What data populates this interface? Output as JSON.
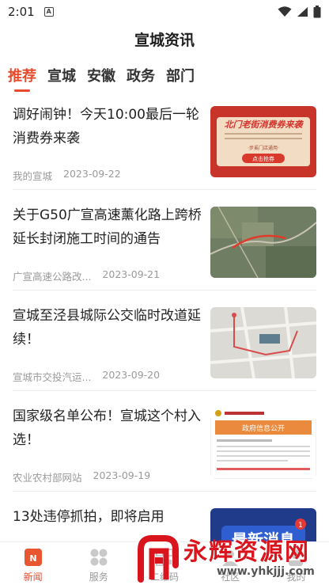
{
  "status": {
    "time": "2:01",
    "indicator": "A"
  },
  "app": {
    "title": "宣城资讯"
  },
  "tabs": [
    {
      "label": "推荐",
      "active": true
    },
    {
      "label": "宣城",
      "active": false
    },
    {
      "label": "安徽",
      "active": false
    },
    {
      "label": "政务",
      "active": false
    },
    {
      "label": "部门",
      "active": false
    }
  ],
  "news": [
    {
      "title": "调好闹钟！今天10:00最后一轮消费券来袭",
      "source": "我的宣城",
      "date": "2023-09-22",
      "thumb": {
        "headline": "北门老街消费券来袭",
        "note": "·步奚门店通用·",
        "button": "点击抢券"
      }
    },
    {
      "title": "关于G50广宣高速薰化路上跨桥延长封闭施工时间的通告",
      "source": "广宣高速公路改...",
      "date": "2023-09-21"
    },
    {
      "title": "宣城至泾县城际公交临时改道延续！",
      "source": "宣城市交投汽运...",
      "date": "2023-09-20"
    },
    {
      "title": "国家级名单公布！宣城这个村入选！",
      "source": "农业农村部网站",
      "date": "2023-09-19",
      "thumb": {
        "banner": "政府信息公开"
      }
    },
    {
      "title": "13处违停抓拍，即将启用",
      "source": "",
      "date": "",
      "thumb": {
        "headline": "最新消息",
        "badge": "1"
      }
    }
  ],
  "bottom_nav": [
    {
      "label": "新闻",
      "icon": "news-icon",
      "active": true
    },
    {
      "label": "服务",
      "icon": "services-grid-icon",
      "active": false
    },
    {
      "label": "二维码",
      "icon": "qrcode-icon",
      "active": false
    },
    {
      "label": "社区",
      "icon": "community-icon",
      "active": false
    },
    {
      "label": "我的",
      "icon": "profile-icon",
      "active": false
    }
  ],
  "watermark": {
    "text": "永辉资源网",
    "url": "www.yhkjjj.com"
  },
  "colors": {
    "accent": "#e64b2e",
    "watermark": "#d9141d"
  }
}
